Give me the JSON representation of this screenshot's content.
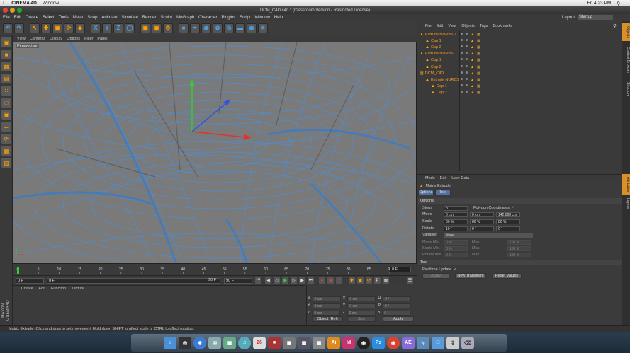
{
  "mac_menubar": {
    "apple": "",
    "app_name": "CINEMA 4D",
    "menu": "Window",
    "clock": "Fri 4:23 PM"
  },
  "window": {
    "title": "DCM_C4D.c4d * (Classroom Version - Restricted License)"
  },
  "menubar": {
    "items": [
      "File",
      "Edit",
      "Create",
      "Select",
      "Tools",
      "Mesh",
      "Snap",
      "Animate",
      "Simulate",
      "Render",
      "Sculpt",
      "MoGraph",
      "Character",
      "Plugins",
      "Script",
      "Window",
      "Help"
    ],
    "layout_label": "Layout:",
    "layout_value": "Startup"
  },
  "viewport": {
    "menu": [
      "View",
      "Cameras",
      "Display",
      "Options",
      "Filter",
      "Panel"
    ],
    "label": "Perspective"
  },
  "timeline": {
    "ticks": [
      "0",
      "5",
      "10",
      "15",
      "20",
      "25",
      "30",
      "35",
      "40",
      "45",
      "50",
      "55",
      "60",
      "65",
      "70",
      "75",
      "80",
      "85",
      "90"
    ],
    "current_frame": "0 F",
    "start_field": "0 F",
    "left_field": "0 F",
    "end_field": "90 F",
    "end_field2": "90 F"
  },
  "material_manager": {
    "menu": [
      "Create",
      "Edit",
      "Function",
      "Texture"
    ],
    "brand": "MAXON CINEMA 4D"
  },
  "coordinates": {
    "rows": [
      {
        "axis": "X",
        "pos": "0 cm",
        "axis2": "X",
        "size": "0 cm",
        "axis3": "H",
        "rot": "0 °"
      },
      {
        "axis": "Y",
        "pos": "0 cm",
        "axis2": "Y",
        "size": "0 cm",
        "axis3": "P",
        "rot": "0 °"
      },
      {
        "axis": "Z",
        "pos": "0 cm",
        "axis2": "Z",
        "size": "0 cm",
        "axis3": "B",
        "rot": "0 °"
      }
    ],
    "mode": "Object (Rel)",
    "size_mode": "Size",
    "apply": "Apply"
  },
  "object_manager": {
    "menu": [
      "File",
      "Edit",
      "View",
      "Objects",
      "Tags",
      "Bookmarks"
    ],
    "objects": [
      {
        "name": "Extrude NURBS.1",
        "level": 0
      },
      {
        "name": "Cap 1",
        "level": 1
      },
      {
        "name": "Cap 2",
        "level": 1
      },
      {
        "name": "Extrude NURBS",
        "level": 0
      },
      {
        "name": "Cap 1",
        "level": 1
      },
      {
        "name": "Cap 2",
        "level": 1
      },
      {
        "name": "DCM_C4D",
        "level": 0
      },
      {
        "name": "Extrude NURBS",
        "level": 1
      },
      {
        "name": "Cap 1",
        "level": 2
      },
      {
        "name": "Cap 2",
        "level": 2
      }
    ]
  },
  "side_tabs": [
    "Objects",
    "Content Browser",
    "Structure",
    "Attributes",
    "Layers"
  ],
  "attributes": {
    "menu": [
      "Mode",
      "Edit",
      "User Data"
    ],
    "tool_name": "Matrix Extrude",
    "tabs": [
      "Options",
      "Tool"
    ],
    "section_options": "Options",
    "steps_label": "Steps",
    "steps_value": "8",
    "poly_coords_label": "Polygon Coordinates",
    "poly_coords_check": "✓",
    "move_label": "Move",
    "move_values": [
      "0 cm",
      "0 cm",
      "142.868 cm"
    ],
    "scale_label": "Scale",
    "scale_values": [
      "80 %",
      "80 %",
      "80 %"
    ],
    "rotate_label": "Rotate",
    "rotate_values": [
      "10 °",
      "0 °",
      "0 °"
    ],
    "variation_label": "Variation",
    "variation_value": "None",
    "move_min_label": "Move Min.",
    "move_min": "0 %",
    "move_max_label": "Max.",
    "move_max": "100 %",
    "scale_min_label": "Scale Min.",
    "scale_min": "0 %",
    "scale_max_label": "Max.",
    "scale_max": "100 %",
    "rotate_min_label": "Rotate Min.",
    "rotate_min": "0 %",
    "rotate_max_label": "Max.",
    "rotate_max": "100 %",
    "section_tool": "Tool",
    "realtime_label": "Realtime Update",
    "realtime_check": "✓",
    "apply_btn": "Apply",
    "new_transform_btn": "New Transform",
    "reset_btn": "Reset Values"
  },
  "statusbar": {
    "text": "Matrix Extrude: Click and drag to set movement. Hold down SHIFT to affect scale or CTRL to affect rotation."
  },
  "dock": {
    "items": [
      "finder",
      "dashboard",
      "safari",
      "mail",
      "preview",
      "itunes",
      "calendar",
      "app",
      "photo",
      "app2",
      "app3",
      "illustrator",
      "indesign",
      "app4",
      "photoshop",
      "chrome",
      "aftereffects",
      "app5",
      "folder",
      "downloads",
      "trash"
    ],
    "labels": {
      "ai": "Ai",
      "id": "Id",
      "ps": "Ps",
      "ae": "AE"
    },
    "colors": {
      "ai": "#e08a1e",
      "id": "#c8326e",
      "ps": "#2a8de0",
      "ae": "#8a6ad8",
      "chrome": "#d9432f"
    }
  },
  "colors": {
    "accent": "#d9902a",
    "wire": "#4d8fd6",
    "viewport_bg": "#7a7a7a"
  }
}
